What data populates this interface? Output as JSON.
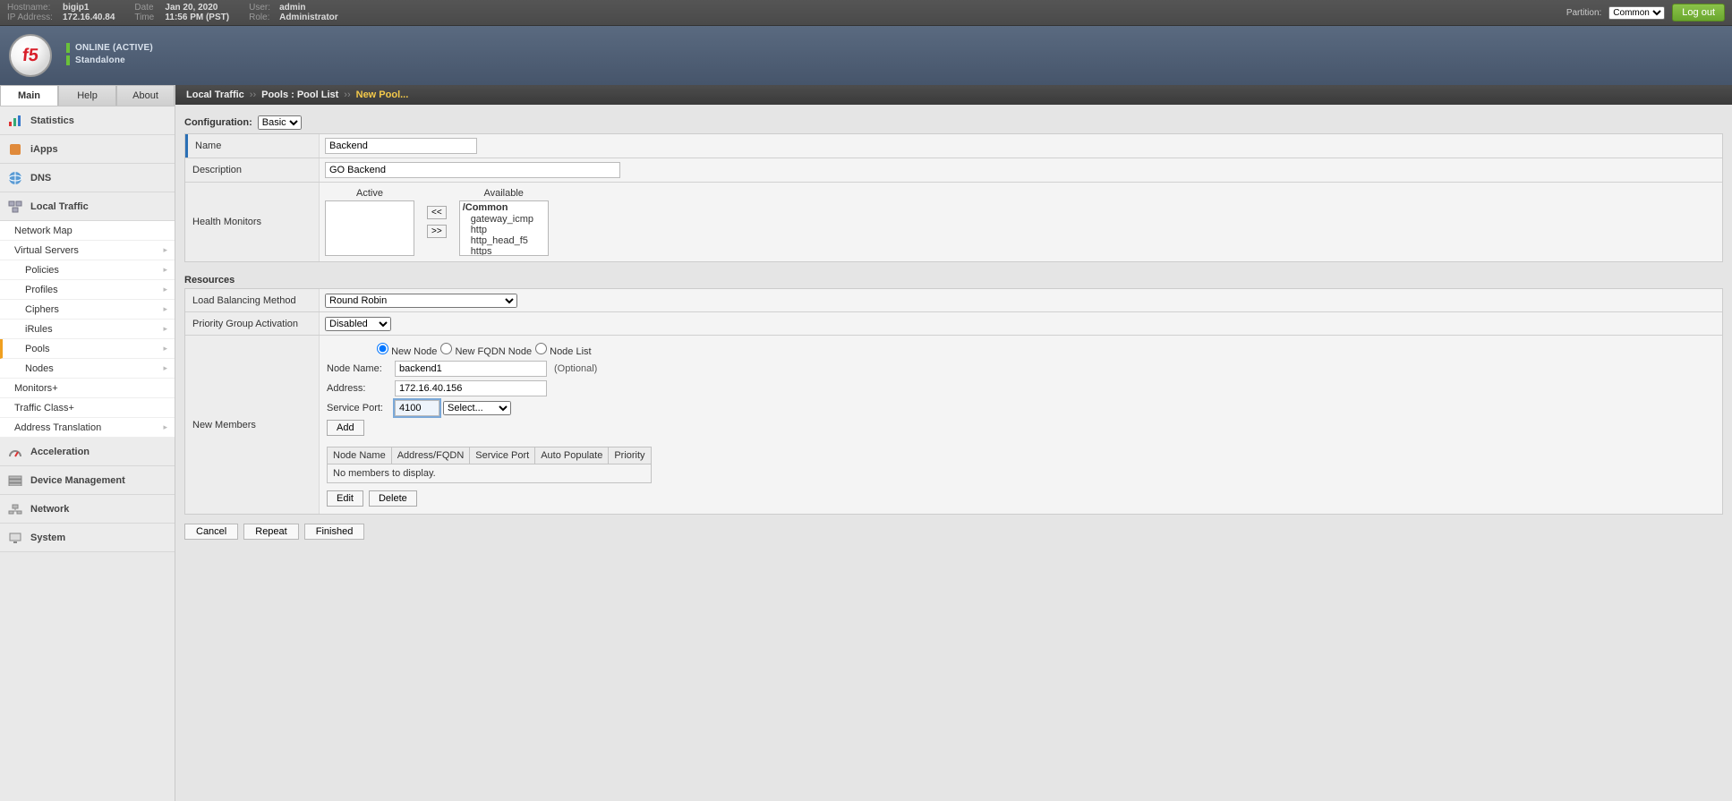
{
  "topbar": {
    "hostname_lbl": "Hostname:",
    "hostname": "bigip1",
    "ip_lbl": "IP Address:",
    "ip": "172.16.40.84",
    "date_lbl": "Date",
    "date": "Jan 20, 2020",
    "time_lbl": "Time",
    "time": "11:56 PM (PST)",
    "user_lbl": "User:",
    "user": "admin",
    "role_lbl": "Role:",
    "role": "Administrator",
    "partition_lbl": "Partition:",
    "partition_sel": "Common",
    "logout": "Log out"
  },
  "header": {
    "status1": "ONLINE (ACTIVE)",
    "status2": "Standalone"
  },
  "side_tabs": {
    "main": "Main",
    "help": "Help",
    "about": "About"
  },
  "nav": {
    "statistics": "Statistics",
    "iapps": "iApps",
    "dns": "DNS",
    "local_traffic": "Local Traffic",
    "lt_sub": {
      "network_map": "Network Map",
      "virtual_servers": "Virtual Servers",
      "policies": "Policies",
      "profiles": "Profiles",
      "ciphers": "Ciphers",
      "irules": "iRules",
      "pools": "Pools",
      "nodes": "Nodes",
      "monitors": "Monitors",
      "traffic_class": "Traffic Class",
      "address_translation": "Address Translation"
    },
    "acceleration": "Acceleration",
    "device_mgmt": "Device Management",
    "network": "Network",
    "system": "System"
  },
  "breadcrumb": {
    "a": "Local Traffic",
    "b": "Pools : Pool List",
    "c": "New Pool..."
  },
  "config": {
    "label": "Configuration:",
    "sel": "Basic"
  },
  "general": {
    "name_lbl": "Name",
    "name_val": "Backend",
    "desc_lbl": "Description",
    "desc_val": "GO Backend",
    "hm_lbl": "Health Monitors",
    "active_lbl": "Active",
    "avail_lbl": "Available",
    "btn_add": "<<",
    "btn_rem": ">>",
    "avail_group": "/Common",
    "avail_opts": [
      "gateway_icmp",
      "http",
      "http_head_f5",
      "https"
    ]
  },
  "resources": {
    "title": "Resources",
    "lb_lbl": "Load Balancing Method",
    "lb_val": "Round Robin",
    "pga_lbl": "Priority Group Activation",
    "pga_val": "Disabled",
    "nm_lbl": "New Members",
    "radio": {
      "new_node": "New Node",
      "fqdn": "New FQDN Node",
      "node_list": "Node List"
    },
    "node_name_lbl": "Node Name:",
    "node_name_val": "backend1",
    "optional": "(Optional)",
    "address_lbl": "Address:",
    "address_val": "172.16.40.156",
    "port_lbl": "Service Port:",
    "port_val": "4100",
    "port_select": "Select...",
    "add_btn": "Add",
    "cols": {
      "node_name": "Node Name",
      "addr": "Address/FQDN",
      "port": "Service Port",
      "auto": "Auto Populate",
      "prio": "Priority"
    },
    "empty_msg": "No members to display.",
    "edit_btn": "Edit",
    "delete_btn": "Delete"
  },
  "footer": {
    "cancel": "Cancel",
    "repeat": "Repeat",
    "finished": "Finished"
  }
}
